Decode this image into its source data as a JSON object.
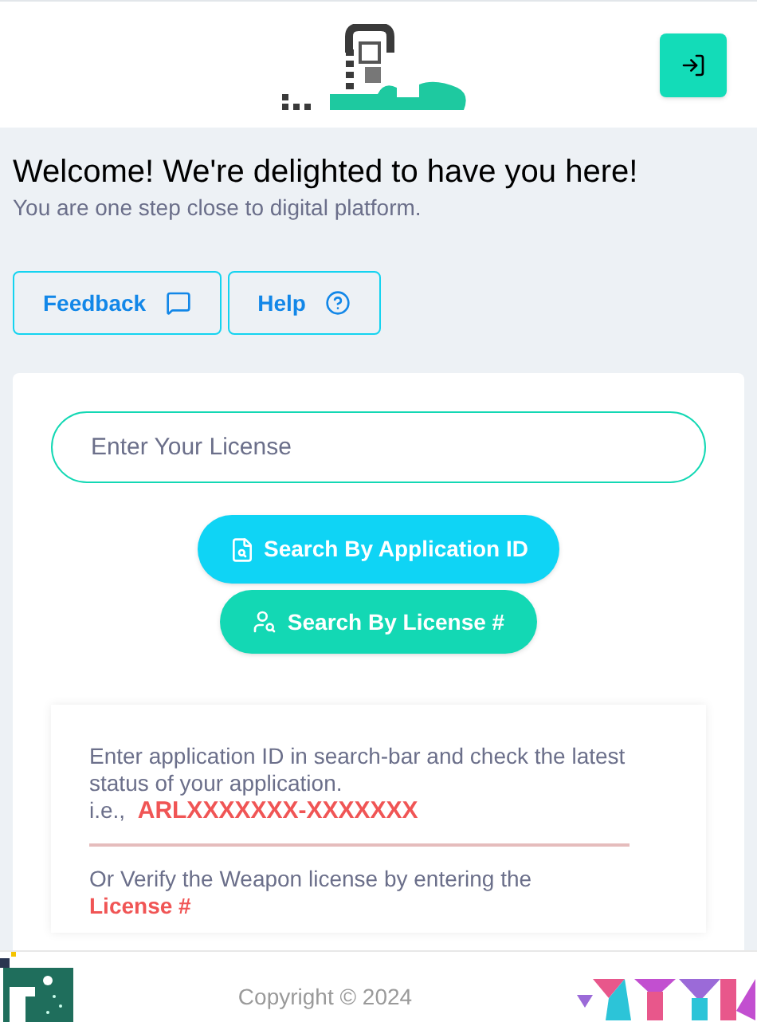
{
  "welcome": {
    "title": "Welcome! We're delighted to have you here!",
    "subtitle": "You are one step close to digital platform."
  },
  "top_buttons": [
    {
      "label": "Feedback",
      "kind": "feedback"
    },
    {
      "label": "Help",
      "kind": "help"
    }
  ],
  "search": {
    "placeholder": "Enter Your License"
  },
  "search_buttons": [
    {
      "label": "Search By Application ID",
      "kind": "application"
    },
    {
      "label": "Search By License #",
      "kind": "license"
    }
  ],
  "info": {
    "line1": "Enter application ID in search-bar and check the latest status of your application.",
    "example_prefix": "i.e.,",
    "example": "ARLXXXXXXX-XXXXXXX",
    "line2": "Or Verify the Weapon license by entering the",
    "line2_highlight": "License #"
  },
  "footer": {
    "copyright": "Copyright © 2024"
  }
}
